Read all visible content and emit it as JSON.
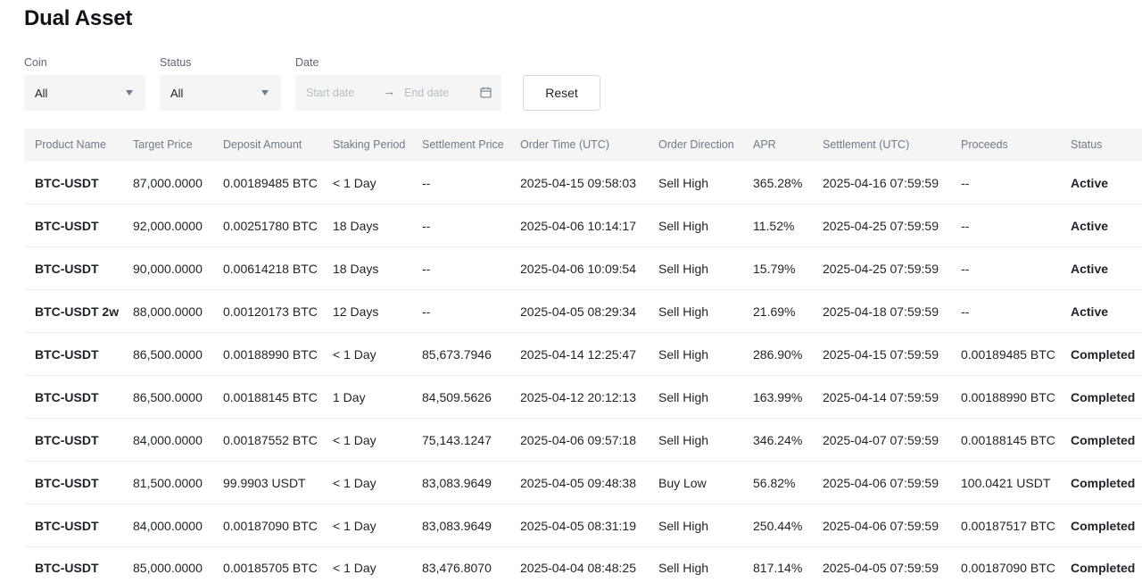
{
  "page": {
    "title": "Dual Asset"
  },
  "filters": {
    "coin": {
      "label": "Coin",
      "value": "All"
    },
    "status": {
      "label": "Status",
      "value": "All"
    },
    "date": {
      "label": "Date",
      "start_placeholder": "Start date",
      "end_placeholder": "End date",
      "arrow": "→"
    },
    "reset_label": "Reset"
  },
  "table": {
    "columns": [
      "Product Name",
      "Target Price",
      "Deposit Amount",
      "Staking Period",
      "Settlement Price",
      "Order Time (UTC)",
      "Order Direction",
      "APR",
      "Settlement (UTC)",
      "Proceeds",
      "Status"
    ],
    "rows": [
      [
        "BTC-USDT",
        "87,000.0000",
        "0.00189485 BTC",
        "< 1 Day",
        "--",
        "2025-04-15 09:58:03",
        "Sell High",
        "365.28%",
        "2025-04-16 07:59:59",
        "--",
        "Active"
      ],
      [
        "BTC-USDT",
        "92,000.0000",
        "0.00251780 BTC",
        "18 Days",
        "--",
        "2025-04-06 10:14:17",
        "Sell High",
        "11.52%",
        "2025-04-25 07:59:59",
        "--",
        "Active"
      ],
      [
        "BTC-USDT",
        "90,000.0000",
        "0.00614218 BTC",
        "18 Days",
        "--",
        "2025-04-06 10:09:54",
        "Sell High",
        "15.79%",
        "2025-04-25 07:59:59",
        "--",
        "Active"
      ],
      [
        "BTC-USDT 2w",
        "88,000.0000",
        "0.00120173 BTC",
        "12 Days",
        "--",
        "2025-04-05 08:29:34",
        "Sell High",
        "21.69%",
        "2025-04-18 07:59:59",
        "--",
        "Active"
      ],
      [
        "BTC-USDT",
        "86,500.0000",
        "0.00188990 BTC",
        "< 1 Day",
        "85,673.7946",
        "2025-04-14 12:25:47",
        "Sell High",
        "286.90%",
        "2025-04-15 07:59:59",
        "0.00189485 BTC",
        "Completed"
      ],
      [
        "BTC-USDT",
        "86,500.0000",
        "0.00188145 BTC",
        "1 Day",
        "84,509.5626",
        "2025-04-12 20:12:13",
        "Sell High",
        "163.99%",
        "2025-04-14 07:59:59",
        "0.00188990 BTC",
        "Completed"
      ],
      [
        "BTC-USDT",
        "84,000.0000",
        "0.00187552 BTC",
        "< 1 Day",
        "75,143.1247",
        "2025-04-06 09:57:18",
        "Sell High",
        "346.24%",
        "2025-04-07 07:59:59",
        "0.00188145 BTC",
        "Completed"
      ],
      [
        "BTC-USDT",
        "81,500.0000",
        "99.9903 USDT",
        "< 1 Day",
        "83,083.9649",
        "2025-04-05 09:48:38",
        "Buy Low",
        "56.82%",
        "2025-04-06 07:59:59",
        "100.0421 USDT",
        "Completed"
      ],
      [
        "BTC-USDT",
        "84,000.0000",
        "0.00187090 BTC",
        "< 1 Day",
        "83,083.9649",
        "2025-04-05 08:31:19",
        "Sell High",
        "250.44%",
        "2025-04-06 07:59:59",
        "0.00187517 BTC",
        "Completed"
      ],
      [
        "BTC-USDT",
        "85,000.0000",
        "0.00185705 BTC",
        "< 1 Day",
        "83,476.8070",
        "2025-04-04 08:48:25",
        "Sell High",
        "817.14%",
        "2025-04-05 07:59:59",
        "0.00187090 BTC",
        "Completed"
      ]
    ]
  },
  "colors": {
    "text": "#1e2329",
    "muted": "#707a8a",
    "header_bg": "#f5f5f5"
  }
}
